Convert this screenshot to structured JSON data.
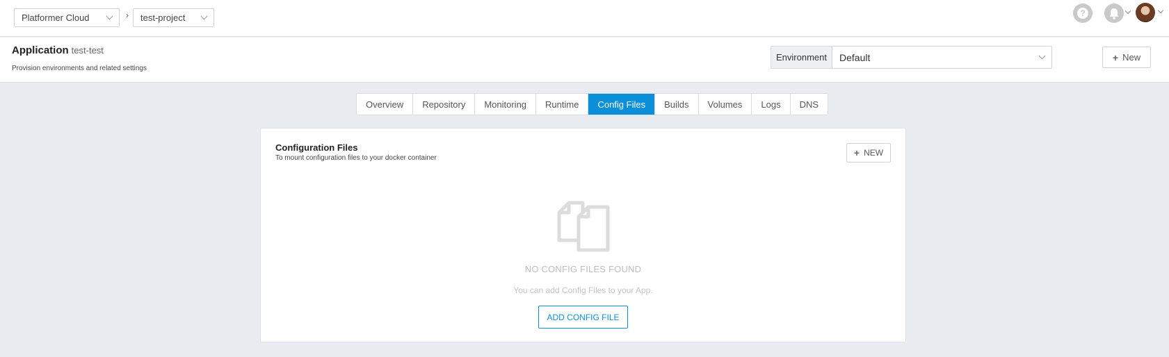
{
  "topbar": {
    "org_select": "Platformer Cloud",
    "breadcrumb_sep": "›",
    "project_select": "test-project",
    "help_symbol": "?"
  },
  "header": {
    "title": "Application",
    "app_name": "test-test",
    "subtitle": "Provision environments and related settings",
    "environment_label": "Environment",
    "environment_value": "Default",
    "new_label": "New"
  },
  "tabs": [
    {
      "label": "Overview"
    },
    {
      "label": "Repository"
    },
    {
      "label": "Monitoring"
    },
    {
      "label": "Runtime"
    },
    {
      "label": "Config Files"
    },
    {
      "label": "Builds"
    },
    {
      "label": "Volumes"
    },
    {
      "label": "Logs"
    },
    {
      "label": "DNS"
    }
  ],
  "active_tab": "Config Files",
  "card": {
    "title": "Configuration Files",
    "subtitle": "To mount configuration files to your docker container",
    "new_label": "NEW",
    "empty_title": "NO CONFIG FILES FOUND",
    "empty_subtitle": "You can add Config Files to your App.",
    "add_button": "ADD CONFIG FILE"
  },
  "colors": {
    "accent": "#0a8fd8",
    "background": "#e9ecf1"
  },
  "icons": [
    "chevron-down-icon",
    "help-icon",
    "bell-icon",
    "avatar",
    "plus-icon",
    "files-icon"
  ]
}
